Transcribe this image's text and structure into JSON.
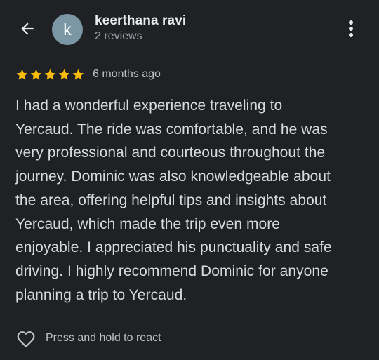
{
  "header": {
    "avatar_letter": "k",
    "name": "keerthana ravi",
    "reviews_count": "2 reviews"
  },
  "review": {
    "rating": 5,
    "max_rating": 5,
    "time_ago": "6 months ago",
    "text": "I had a wonderful experience traveling to\nYercaud. The ride was comfortable, and he was\nvery professional and courteous throughout the\njourney. Dominic was also knowledgeable about\nthe area, offering helpful tips and insights about\nYercaud, which made the trip even more\nenjoyable. I appreciated his punctuality and safe\ndriving. I highly recommend Dominic for anyone\nplanning a trip to Yercaud."
  },
  "footer": {
    "react_label": "Press and hold to react"
  },
  "icons": {
    "back": "back-arrow-icon",
    "more": "more-vert-icon",
    "star": "star-icon",
    "heart": "heart-outline-icon"
  },
  "colors": {
    "background": "#202124",
    "star": "#fbbc04",
    "avatar": "#7b97a6",
    "primary_text": "#e8eaed",
    "secondary_text": "#9aa0a6"
  }
}
